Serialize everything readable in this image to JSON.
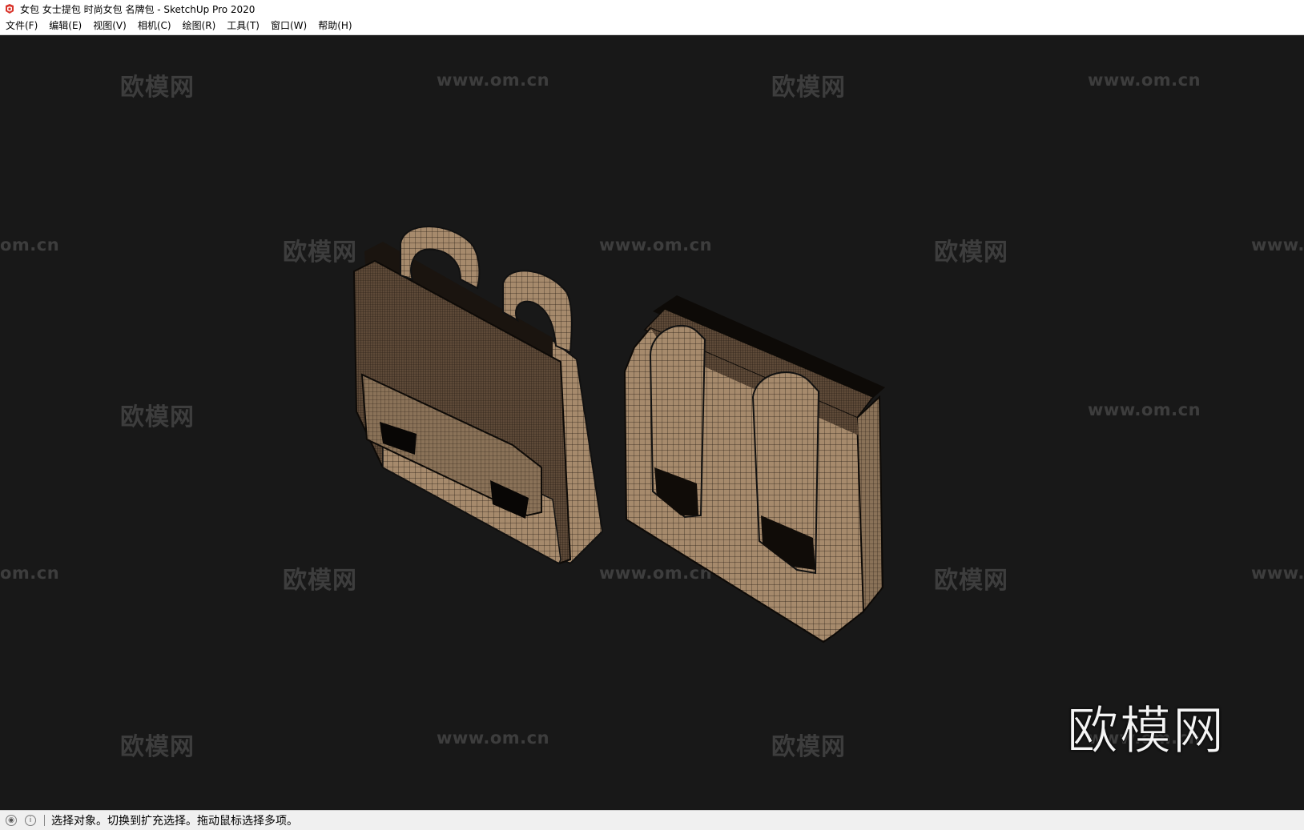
{
  "window": {
    "title": "女包 女士提包 时尚女包 名牌包 - SketchUp Pro 2020",
    "app_icon": "sketchup-icon"
  },
  "menubar": {
    "items": [
      {
        "label": "文件(F)"
      },
      {
        "label": "编辑(E)"
      },
      {
        "label": "视图(V)"
      },
      {
        "label": "相机(C)"
      },
      {
        "label": "绘图(R)"
      },
      {
        "label": "工具(T)"
      },
      {
        "label": "窗口(W)"
      },
      {
        "label": "帮助(H)"
      }
    ]
  },
  "viewport": {
    "background_color": "#181818",
    "model_color": "#a68a6c",
    "watermark_cn": "欧模网",
    "watermark_url": "www.om.cn",
    "watermark_url_partial_left": "om.cn",
    "watermark_url_partial_right": "www.",
    "logo_text": "欧模网"
  },
  "statusbar": {
    "icons": [
      "geo-location-icon",
      "info-icon"
    ],
    "message": "选择对象。切换到扩充选择。拖动鼠标选择多项。"
  }
}
